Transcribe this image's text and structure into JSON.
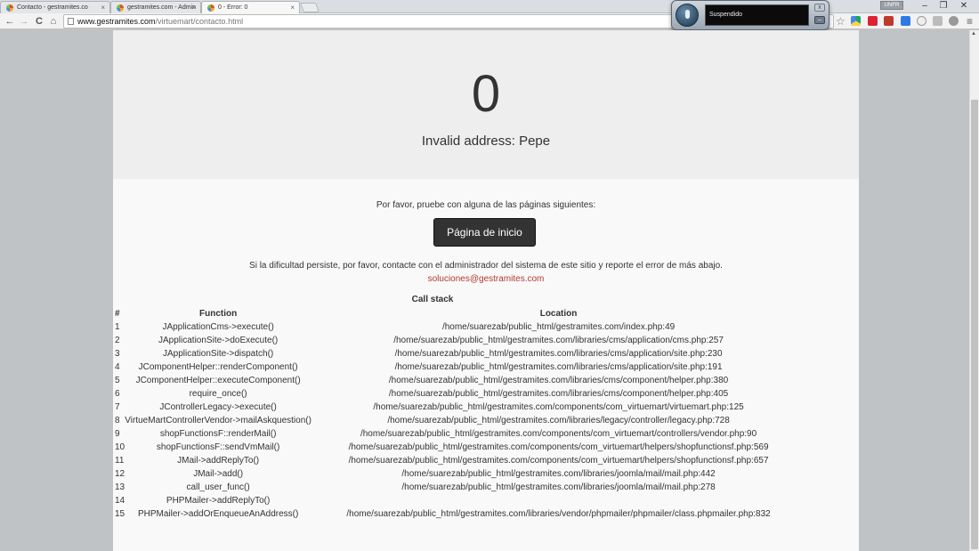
{
  "browser": {
    "tabs": [
      {
        "title": "Contacto - gestramites.co",
        "active": false,
        "favicon": "joomla-icon"
      },
      {
        "title": "gestramites.com - Admin",
        "active": false,
        "favicon": "joomla-icon"
      },
      {
        "title": "0 - Error: 0",
        "active": true,
        "favicon": "joomla-icon"
      }
    ],
    "close_glyph": "×",
    "url_host": "www.gestramites.com",
    "url_path": "/virtuemart/contacto.html",
    "window_controls": {
      "minimize": "–",
      "restore": "❐",
      "close": "✕"
    },
    "user_chip": "UNFR",
    "nav": {
      "back": "←",
      "forward": "→",
      "reload": "C",
      "home": "⌂"
    },
    "star_glyph": "☆",
    "menu_glyph": "≡"
  },
  "voice_widget": {
    "status": "Suspendido",
    "close": "x",
    "minimize": "–"
  },
  "error_page": {
    "code": "0",
    "message": "Invalid address: Pepe",
    "prompt": "Por favor, pruebe con alguna de las páginas siguientes:",
    "home_button": "Página de inicio",
    "persist_text": "Si la dificultad persiste, por favor, contacte con el administrador del sistema de este sitio y reporte el error de más abajo.",
    "email": "soluciones@gestramites.com",
    "call_stack_title": "Call stack",
    "columns": [
      "#",
      "Function",
      "Location"
    ],
    "rows": [
      [
        "1",
        "JApplicationCms->execute()",
        "/home/suarezab/public_html/gestramites.com/index.php:49"
      ],
      [
        "2",
        "JApplicationSite->doExecute()",
        "/home/suarezab/public_html/gestramites.com/libraries/cms/application/cms.php:257"
      ],
      [
        "3",
        "JApplicationSite->dispatch()",
        "/home/suarezab/public_html/gestramites.com/libraries/cms/application/site.php:230"
      ],
      [
        "4",
        "JComponentHelper::renderComponent()",
        "/home/suarezab/public_html/gestramites.com/libraries/cms/application/site.php:191"
      ],
      [
        "5",
        "JComponentHelper::executeComponent()",
        "/home/suarezab/public_html/gestramites.com/libraries/cms/component/helper.php:380"
      ],
      [
        "6",
        "require_once()",
        "/home/suarezab/public_html/gestramites.com/libraries/cms/component/helper.php:405"
      ],
      [
        "7",
        "JControllerLegacy->execute()",
        "/home/suarezab/public_html/gestramites.com/components/com_virtuemart/virtuemart.php:125"
      ],
      [
        "8",
        "VirtueMartControllerVendor->mailAskquestion()",
        "/home/suarezab/public_html/gestramites.com/libraries/legacy/controller/legacy.php:728"
      ],
      [
        "9",
        "shopFunctionsF::renderMail()",
        "/home/suarezab/public_html/gestramites.com/components/com_virtuemart/controllers/vendor.php:90"
      ],
      [
        "10",
        "shopFunctionsF::sendVmMail()",
        "/home/suarezab/public_html/gestramites.com/components/com_virtuemart/helpers/shopfunctionsf.php:569"
      ],
      [
        "11",
        "JMail->addReplyTo()",
        "/home/suarezab/public_html/gestramites.com/components/com_virtuemart/helpers/shopfunctionsf.php:657"
      ],
      [
        "12",
        "JMail->add()",
        "/home/suarezab/public_html/gestramites.com/libraries/joomla/mail/mail.php:442"
      ],
      [
        "13",
        "call_user_func()",
        "/home/suarezab/public_html/gestramites.com/libraries/joomla/mail/mail.php:278"
      ],
      [
        "14",
        "PHPMailer->addReplyTo()",
        ""
      ],
      [
        "15",
        "PHPMailer->addOrEnqueueAnAddress()",
        "/home/suarezab/public_html/gestramites.com/libraries/vendor/phpmailer/phpmailer/class.phpmailer.php:832"
      ]
    ]
  },
  "colors": {
    "email_link": "#b3392e",
    "button_bg": "#333333",
    "hero_bg": "#eeeeee"
  }
}
